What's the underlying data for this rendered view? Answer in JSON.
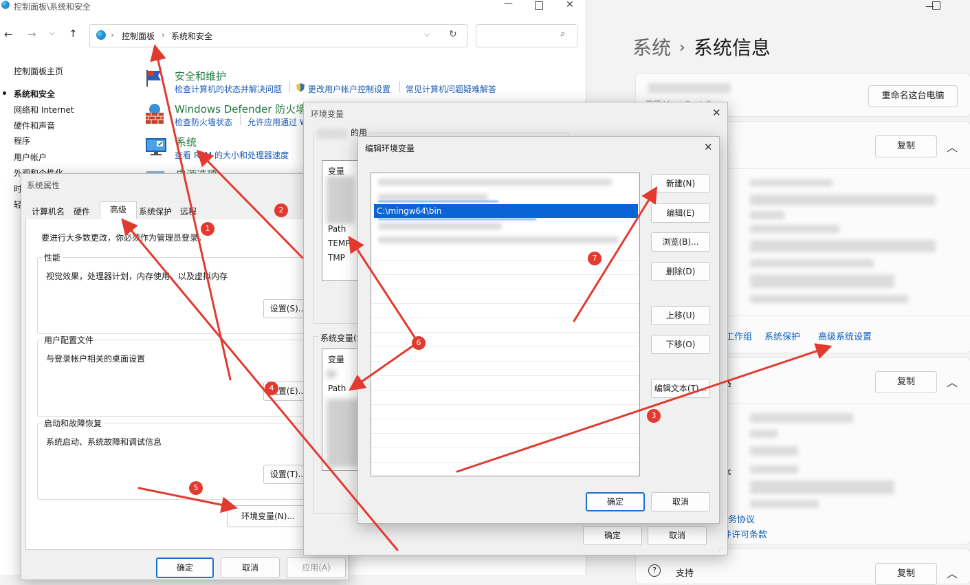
{
  "settings": {
    "breadcrumb_parent": "系统",
    "breadcrumb_current": "系统信息",
    "rename_button": "重命名这台电脑",
    "device_model": "荣耀 MagicBook Pro",
    "copy_button_1": "复制",
    "copy_button_2": "复制",
    "copy_button_3": "复制",
    "related_links": [
      "工作组",
      "系统保护",
      "高级系统设置"
    ],
    "partial_label_1": "格",
    "partial_label_2": "本",
    "link_service": "务协议",
    "link_license": "件许可条款",
    "support_label": "支持"
  },
  "control_panel": {
    "title": "控制面板\\系统和安全",
    "address": [
      "控制面板",
      "系统和安全"
    ],
    "nav": [
      "控制面板主页",
      "系统和安全",
      "网络和 Internet",
      "硬件和声音",
      "程序",
      "用户帐户",
      "外观和个性化",
      "时",
      "轻"
    ],
    "sections": [
      {
        "title": "安全和维护",
        "links": [
          "检查计算机的状态并解决问题",
          "更改用户帐户控制设置",
          "常见计算机问题疑难解答"
        ]
      },
      {
        "title": "Windows Defender 防火墙",
        "links": [
          "检查防火墙状态",
          "允许应用通过 W"
        ]
      },
      {
        "title": "系统",
        "links": [
          "查看 RAM 的大小和处理器速度"
        ]
      },
      {
        "title": "电源选项",
        "links": []
      }
    ]
  },
  "system_properties": {
    "title": "系统属性",
    "tabs": [
      "计算机名",
      "硬件",
      "高级",
      "系统保护",
      "远程"
    ],
    "admin_note": "要进行大多数更改，你必须作为管理员登录。",
    "performance": {
      "label": "性能",
      "desc": "视觉效果，处理器计划，内存使用，以及虚拟内存",
      "button": "设置(S)..."
    },
    "profiles": {
      "label": "用户配置文件",
      "desc": "与登录帐户相关的桌面设置",
      "button": "设置(E)..."
    },
    "startup": {
      "label": "启动和故障恢复",
      "desc": "系统启动、系统故障和调试信息",
      "button": "设置(T)..."
    },
    "env_button": "环境变量(N)...",
    "ok": "确定",
    "cancel": "取消",
    "apply": "应用(A)"
  },
  "env_vars": {
    "title": "环境变量",
    "user_label_suffix": "的用",
    "col_variable": "变量",
    "user_vars": [
      "Path",
      "TEMP",
      "TMP"
    ],
    "system_label": "系统变量(S)",
    "system_col": "变量",
    "system_vars": [
      "Path"
    ],
    "ok": "确定",
    "cancel": "取消"
  },
  "edit_env": {
    "title": "编辑环境变量",
    "selected_entry": "C:\\mingw64\\bin",
    "buttons": [
      "新建(N)",
      "编辑(E)",
      "浏览(B)...",
      "删除(D)",
      "上移(U)",
      "下移(O)",
      "编辑文本(T)..."
    ],
    "ok": "确定",
    "cancel": "取消"
  },
  "annotations": [
    "1",
    "2",
    "3",
    "4",
    "5",
    "6",
    "7"
  ],
  "colors": {
    "arrow": "#e23a2e",
    "selection": "#0a64d6",
    "link": "#1a5cb8",
    "green_title": "#1f7a3f"
  }
}
